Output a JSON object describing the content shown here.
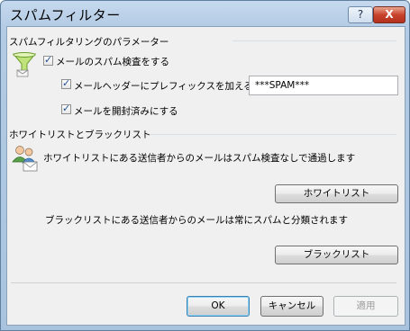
{
  "window": {
    "title": "スパムフィルター"
  },
  "titlebar": {
    "help_label": "?",
    "close_label": "X"
  },
  "spam_params": {
    "heading": "スパムフィルタリングのパラメーター",
    "enable_check_label": "メールのスパム検査をする",
    "prefix_check_label": "メールヘッダーにプレフィックスを加える",
    "prefix_value": "***SPAM***",
    "mark_read_label": "メールを開封済みにする",
    "checks": {
      "enable": true,
      "prefix": true,
      "mark_read": true
    }
  },
  "lists": {
    "heading": "ホワイトリストとブラックリスト",
    "whitelist_text": "ホワイトリストにある送信者からのメールはスパム検査なしで通過します",
    "whitelist_button": "ホワイトリスト",
    "blacklist_text": "ブラックリストにある送信者からのメールは常にスパムと分類されます",
    "blacklist_button": "ブラックリスト"
  },
  "footer": {
    "ok_label": "OK",
    "cancel_label": "キャンセル",
    "apply_label": "適用"
  },
  "icons": {
    "filter": "funnel-icon",
    "users": "users-mail-icon"
  }
}
